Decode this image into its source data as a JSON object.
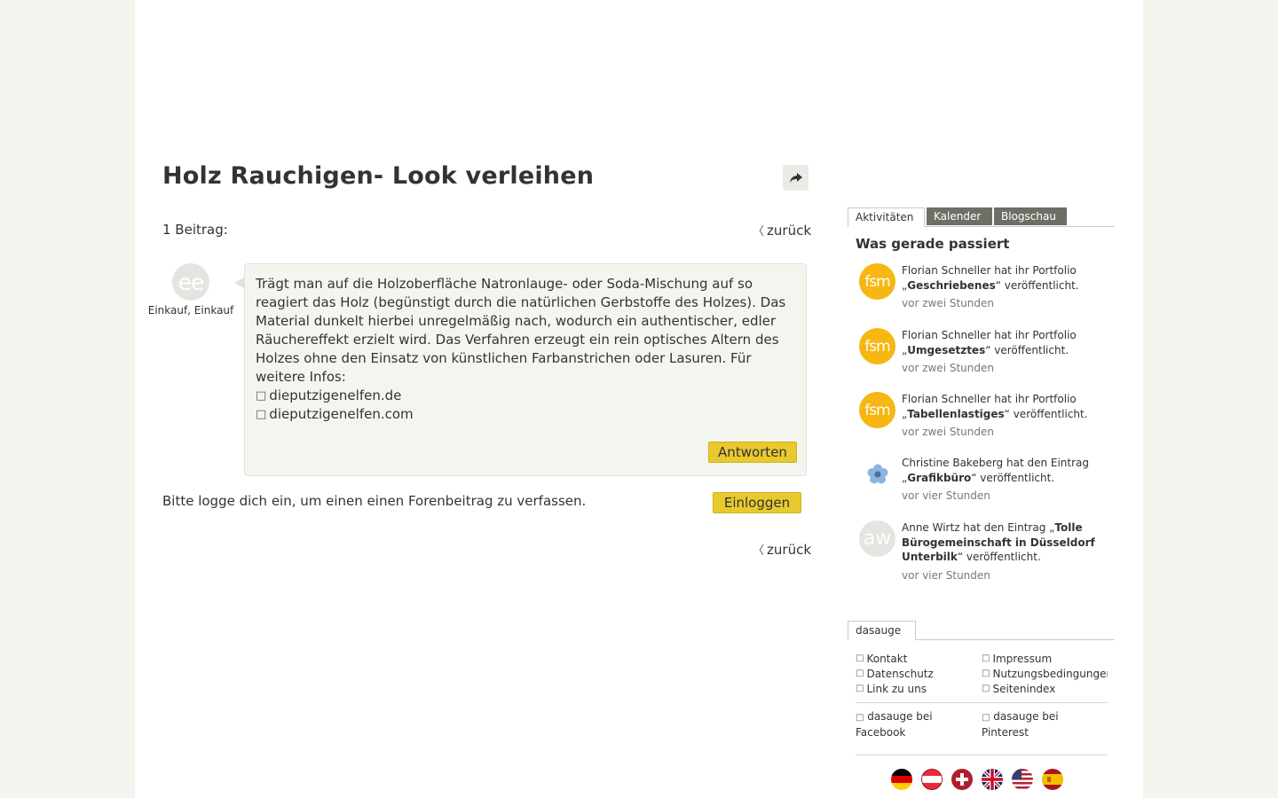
{
  "article": {
    "title": "Holz Rauchigen- Look verleihen",
    "post_count": "1 Beitrag:",
    "back_label": "zurück"
  },
  "post": {
    "author_initials": "ee",
    "author_name": "Einkauf, Einkauf",
    "body": "Trägt man auf die Holzoberfläche Natronlauge- oder Soda-Mischung auf so reagiert das Holz (begünstigt durch die natürlichen Gerbstoffe des Holzes). Das Material dunkelt hierbei unregelmäßig nach, wodurch ein authentischer, edler Räuchereffekt erzielt wird. Das Verfahren erzeugt ein rein optisches Altern des Holzes ohne den Einsatz von künstlichen Farbanstrichen oder Lasuren. Für weitere Infos:",
    "links": [
      "dieputzigenelfen.de",
      "dieputzigenelfen.com"
    ],
    "reply_label": "Antworten"
  },
  "login": {
    "text": "Bitte logge dich ein, um einen einen Forenbeitrag zu verfassen.",
    "button_label": "Einloggen"
  },
  "sidebar": {
    "tabs": [
      "Aktivitäten",
      "Kalender",
      "Blogschau"
    ],
    "heading": "Was gerade passiert",
    "activities": [
      {
        "avatar": "fsm",
        "prefix": "Florian Schneller hat ihr Portfolio „",
        "item": "Geschriebenes",
        "suffix": "“ veröffentlicht.",
        "time": "vor zwei Stunden"
      },
      {
        "avatar": "fsm",
        "prefix": "Florian Schneller hat ihr Portfolio „",
        "item": "Umgesetztes",
        "suffix": "“ veröffentlicht.",
        "time": "vor zwei Stunden"
      },
      {
        "avatar": "fsm",
        "prefix": "Florian Schneller hat ihr Portfolio „",
        "item": "Tabellenlastiges",
        "suffix": "“ veröffentlicht.",
        "time": "vor zwei Stunden"
      },
      {
        "avatar": "flower",
        "prefix": "Christine Bakeberg hat den Eintrag „",
        "item": "Grafikbüro",
        "suffix": "“ veröffentlicht.",
        "time": "vor vier Stunden"
      },
      {
        "avatar": "aw",
        "prefix": "Anne Wirtz hat den Eintrag „",
        "item": "Tolle Bürogemeinschaft in Düsseldorf Unterbilk",
        "suffix": "“ veröffentlicht.",
        "time": "vor vier Stunden"
      }
    ],
    "site_tab": "dasauge",
    "links_left": [
      "Kontakt",
      "Datenschutz",
      "Link zu uns"
    ],
    "links_right": [
      "Impressum",
      "Nutzungsbedingungen",
      "Seitenindex"
    ],
    "social_facebook": "dasauge bei Facebook",
    "social_pinterest": "dasauge bei Pinterest"
  },
  "colors": {
    "accent_yellow": "#e8c92e",
    "avatar_orange": "#f6b712",
    "tab_inactive": "#6e6e66",
    "page_bg": "#f4f3ee"
  }
}
